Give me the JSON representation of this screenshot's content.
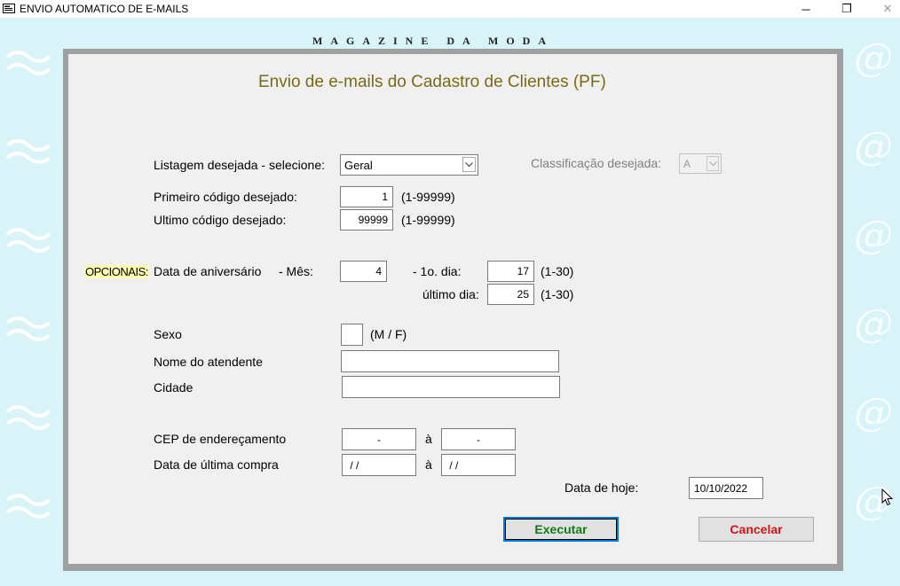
{
  "window": {
    "title": "ENVIO AUTOMATICO DE E-MAILS",
    "controls": {
      "minimize": "─",
      "restore": "❐",
      "close": "✕"
    }
  },
  "brand": "MAGAZINE DA MODA",
  "form": {
    "heading": "Envio de e-mails do Cadastro de Clientes (PF)",
    "listagem": {
      "label": "Listagem desejada - selecione:",
      "value": "Geral"
    },
    "classificacao": {
      "label": "Classificação desejada:",
      "value": "A"
    },
    "primeiro_codigo": {
      "label": "Primeiro código desejado:",
      "value": "1",
      "range": "(1-99999)"
    },
    "ultimo_codigo": {
      "label": "Ultimo código desejado:",
      "value": "99999",
      "range": "(1-99999)"
    },
    "opcionais_label": "OPCIONAIS:",
    "aniversario": {
      "label": "Data de aniversário",
      "mes_label": "-  Mês:",
      "mes_value": "4",
      "primeiro_dia_label": "- 1o. dia:",
      "primeiro_dia_value": "17",
      "primeiro_dia_range": "(1-30)",
      "ultimo_dia_label": "último dia:",
      "ultimo_dia_value": "25",
      "ultimo_dia_range": "(1-30)"
    },
    "sexo": {
      "label": "Sexo",
      "value": "",
      "hint": "(M / F)"
    },
    "atendente": {
      "label": "Nome do atendente",
      "value": ""
    },
    "cidade": {
      "label": "Cidade",
      "value": ""
    },
    "cep": {
      "label": "CEP de endereçamento",
      "from": "-",
      "sep": "à",
      "to": "-"
    },
    "ultima_compra": {
      "label": "Data de última compra",
      "from": " / /",
      "sep": "à",
      "to": " / /"
    },
    "data_hoje": {
      "label": "Data de hoje:",
      "value": "10/10/2022"
    },
    "buttons": {
      "executar": "Executar",
      "cancelar": "Cancelar"
    }
  },
  "colors": {
    "background": "#d8f4f8",
    "panel_border": "#a0a0a0",
    "heading": "#7a6a14",
    "executar_text": "#0f7a1a",
    "cancelar_text": "#d21414",
    "opcionais_highlight": "#fffcb0"
  },
  "icons": {
    "app": "application-window-icon",
    "dropdown": "chevron-down-icon",
    "cursor": "mouse-pointer-icon"
  }
}
